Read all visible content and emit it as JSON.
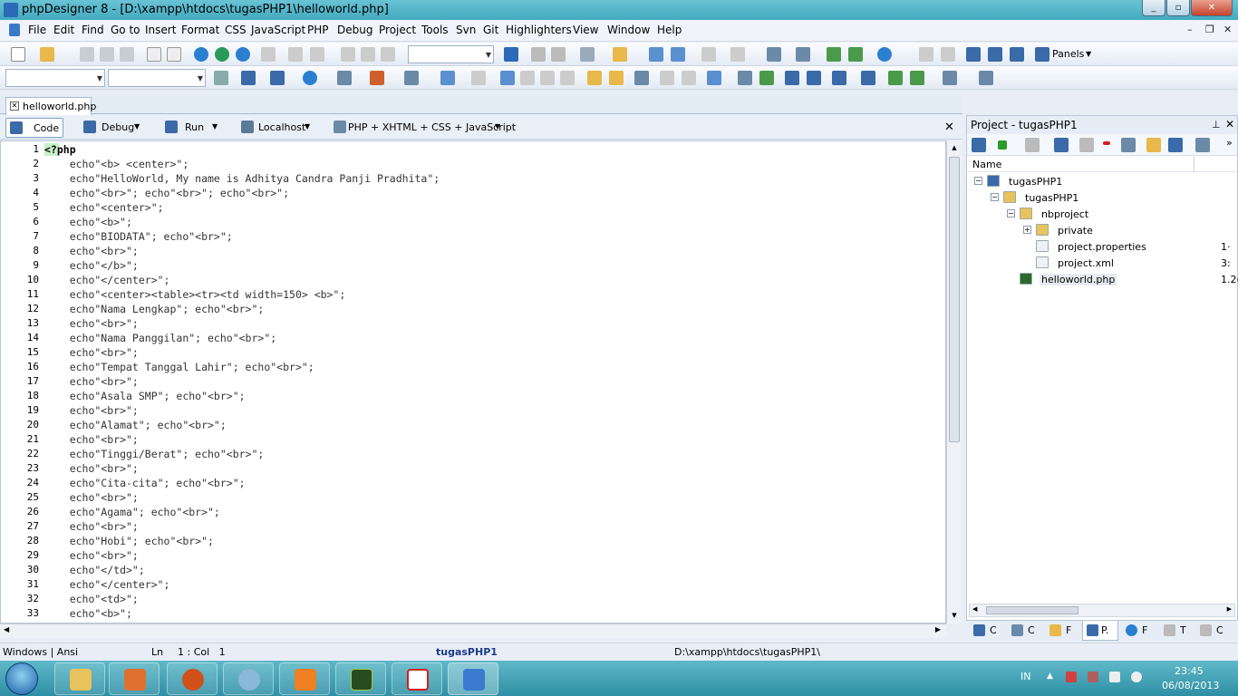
{
  "window": {
    "title": "phpDesigner 8 - [D:\\xampp\\htdocs\\tugasPHP1\\helloworld.php]"
  },
  "menu": {
    "items": [
      "File",
      "Edit",
      "Find",
      "Go to",
      "Insert",
      "Format",
      "CSS",
      "JavaScript",
      "PHP",
      "Debug",
      "Project",
      "Tools",
      "Svn",
      "Git",
      "Highlighters",
      "View",
      "Window",
      "Help"
    ]
  },
  "toolbar": {
    "panels_label": "Panels"
  },
  "tabs": {
    "file": "helloworld.php"
  },
  "runbar": {
    "code": "Code",
    "debug": "Debug",
    "run": "Run",
    "localhost": "Localhost",
    "highlighter": "PHP + XHTML + CSS + JavaScript"
  },
  "editor": {
    "lines": [
      "<?php",
      "    echo\"<b> <center>\";",
      "    echo\"HelloWorld, My name is Adhitya Candra Panji Pradhita\";",
      "    echo\"<br>\"; echo\"<br>\"; echo\"<br>\";",
      "    echo\"<center>\";",
      "    echo\"<b>\";",
      "    echo\"BIODATA\"; echo\"<br>\";",
      "    echo\"<br>\";",
      "    echo\"</b>\";",
      "    echo\"</center>\";",
      "    echo\"<center><table><tr><td width=150> <b>\";",
      "    echo\"Nama Lengkap\"; echo\"<br>\";",
      "    echo\"<br>\";",
      "    echo\"Nama Panggilan\"; echo\"<br>\";",
      "    echo\"<br>\";",
      "    echo\"Tempat Tanggal Lahir\"; echo\"<br>\";",
      "    echo\"<br>\";",
      "    echo\"Asala SMP\"; echo\"<br>\";",
      "    echo\"<br>\";",
      "    echo\"Alamat\"; echo\"<br>\";",
      "    echo\"<br>\";",
      "    echo\"Tinggi/Berat\"; echo\"<br>\";",
      "    echo\"<br>\";",
      "    echo\"Cita-cita\"; echo\"<br>\";",
      "    echo\"<br>\";",
      "    echo\"Agama\"; echo\"<br>\";",
      "    echo\"<br>\";",
      "    echo\"Hobi\"; echo\"<br>\";",
      "    echo\"<br>\";",
      "    echo\"</td>\";",
      "    echo\"</center>\";",
      "    echo\"<td>\";",
      "    echo\"<b>\";"
    ]
  },
  "project_panel": {
    "title": "Project - tugasPHP1",
    "column_name": "Name",
    "tree": [
      {
        "label": "tugasPHP1",
        "size": ""
      },
      {
        "label": "tugasPHP1",
        "size": ""
      },
      {
        "label": "nbproject",
        "size": ""
      },
      {
        "label": "private",
        "size": ""
      },
      {
        "label": "project.properties",
        "size": "1·"
      },
      {
        "label": "project.xml",
        "size": "3:"
      },
      {
        "label": "helloworld.php",
        "size": "1.2("
      }
    ],
    "bottom_tabs": [
      "C",
      "C",
      "F",
      "P.",
      "F",
      "T",
      "C"
    ]
  },
  "statusbar": {
    "encoding": "Windows | Ansi",
    "ln_label": "Ln",
    "position": "1 : Col   1",
    "project": "tugasPHP1",
    "path": "D:\\xampp\\htdocs\\tugasPHP1\\"
  },
  "taskbar": {
    "lang": "IN",
    "time": "23:45",
    "date": "06/08/2013"
  }
}
